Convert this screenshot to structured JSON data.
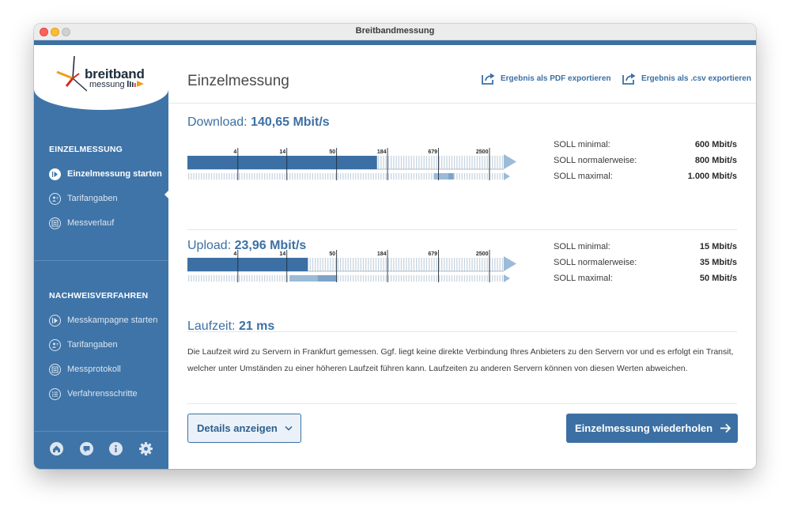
{
  "window": {
    "title": "Breitbandmessung"
  },
  "logo": {
    "line1": "breitband",
    "line2": "messung"
  },
  "sidebar": {
    "section1": {
      "heading": "EINZELMESSUNG",
      "items": [
        {
          "label": "Einzelmessung starten",
          "icon": "play-icon",
          "active": true
        },
        {
          "label": "Tarifangaben",
          "icon": "user-icon",
          "active": false
        },
        {
          "label": "Messverlauf",
          "icon": "list-icon",
          "active": false
        }
      ]
    },
    "section2": {
      "heading": "NACHWEISVERFAHREN",
      "items": [
        {
          "label": "Messkampagne starten",
          "icon": "play-icon"
        },
        {
          "label": "Tarifangaben",
          "icon": "user-icon"
        },
        {
          "label": "Messprotokoll",
          "icon": "list-icon"
        },
        {
          "label": "Verfahrensschritte",
          "icon": "steps-icon"
        }
      ]
    },
    "bottom_icons": [
      "home-icon",
      "chat-icon",
      "info-icon",
      "settings-icon"
    ]
  },
  "main": {
    "title": "Einzelmessung",
    "export_pdf": "Ergebnis als PDF exportieren",
    "export_csv": "Ergebnis als .csv exportieren",
    "scale_ticks": [
      "4",
      "14",
      "50",
      "184",
      "679",
      "2500"
    ],
    "download": {
      "label": "Download:",
      "value": "140,65 Mbit/s",
      "measured": 140.65,
      "soll_range_min": 600,
      "soll_range_max": 1000,
      "soll": [
        {
          "label": "SOLL minimal:",
          "value": "600 Mbit/s"
        },
        {
          "label": "SOLL normalerweise:",
          "value": "800 Mbit/s"
        },
        {
          "label": "SOLL maximal:",
          "value": "1.000 Mbit/s"
        }
      ]
    },
    "upload": {
      "label": "Upload:",
      "value": "23,96 Mbit/s",
      "measured": 23.96,
      "soll_range_min": 15,
      "soll_range_max": 50,
      "soll": [
        {
          "label": "SOLL minimal:",
          "value": "15 Mbit/s"
        },
        {
          "label": "SOLL normalerweise:",
          "value": "35 Mbit/s"
        },
        {
          "label": "SOLL maximal:",
          "value": "50 Mbit/s"
        }
      ]
    },
    "latency": {
      "label": "Laufzeit:",
      "value": "21 ms",
      "description": "Die Laufzeit wird zu Servern in Frankfurt gemessen. Ggf. liegt keine direkte Verbindung Ihres Anbieters zu den Servern vor und es erfolgt ein Transit, welcher unter Umständen zu einer höheren Laufzeit führen kann. Laufzeiten zu anderen Servern können von diesen Werten abweichen."
    },
    "details_button": "Details anzeigen",
    "repeat_button": "Einzelmessung wiederholen"
  },
  "colors": {
    "accent": "#3c70a4",
    "sidebar": "#3f74a8",
    "bar_light": "#9bbbd8"
  }
}
